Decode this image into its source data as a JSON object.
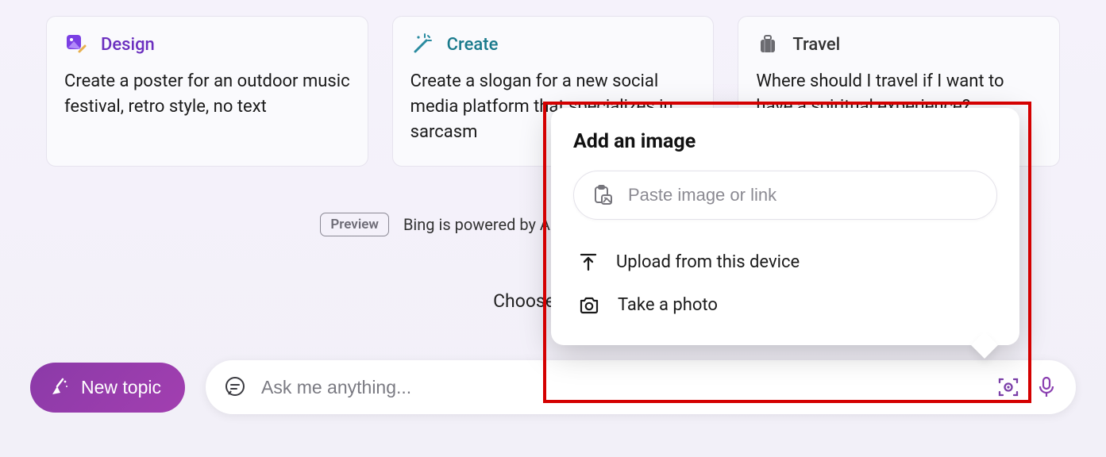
{
  "cards": [
    {
      "category": "Design",
      "prompt": "Create a poster for an outdoor music festival, retro style, no text"
    },
    {
      "category": "Create",
      "prompt": "Create a slogan for a new social media platform that specializes in sarcasm"
    },
    {
      "category": "Travel",
      "prompt": "Where should I travel if I want to have a spiritual experience?"
    }
  ],
  "preview_badge": "Preview",
  "disclaimer": "Bing is powered by AI, so surprises and mistakes are p",
  "choose_style": "Choose a conv",
  "new_topic_label": "New topic",
  "ask_placeholder": "Ask me anything...",
  "popup": {
    "title": "Add an image",
    "paste_placeholder": "Paste image or link",
    "upload_label": "Upload from this device",
    "take_photo_label": "Take a photo"
  }
}
